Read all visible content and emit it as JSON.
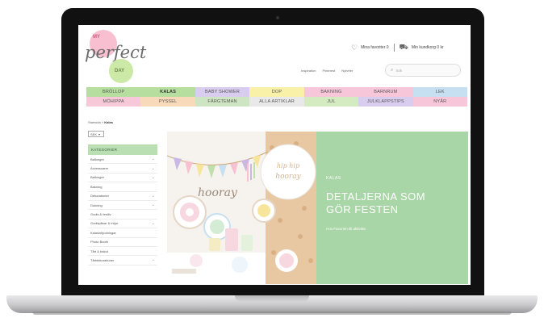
{
  "logo": {
    "my": "MY",
    "perfect": "perfect",
    "day": "DAY"
  },
  "header": {
    "favorites": "Mina favoriter 0",
    "cart": "Min kundkorg 0 kr"
  },
  "nav_links": [
    "Inspiration",
    "Pinterest",
    "Nyheter"
  ],
  "search": {
    "placeholder": "Sök"
  },
  "categories": [
    {
      "label": "BRÖLLOP",
      "color": "#b6de9f",
      "bold": false
    },
    {
      "label": "KALAS",
      "color": "#b6de9f",
      "bold": true
    },
    {
      "label": "BABY SHOWER",
      "color": "#d8cdee",
      "bold": false
    },
    {
      "label": "DOP",
      "color": "#f9f1a7",
      "bold": false
    },
    {
      "label": "BAKNING",
      "color": "#f7c7d9",
      "bold": false
    },
    {
      "label": "BARNRUM",
      "color": "#f7c7d9",
      "bold": false
    },
    {
      "label": "LEK",
      "color": "#c7e0f1",
      "bold": false
    },
    {
      "label": "MÖHIPPA",
      "color": "#f7c9d8",
      "bold": false
    },
    {
      "label": "PYSSEL",
      "color": "#f8d9ba",
      "bold": false
    },
    {
      "label": "FÄRGTEMAN",
      "color": "#cde5c2",
      "bold": false
    },
    {
      "label": "ALLA ARTIKLAR",
      "color": "#e9e9e9",
      "bold": false
    },
    {
      "label": "JUL",
      "color": "#d4ebc1",
      "bold": false
    },
    {
      "label": "JULKLAPPSTIPS",
      "color": "#d8cdee",
      "bold": false
    },
    {
      "label": "NYÅR",
      "color": "#f7c7d9",
      "bold": false
    }
  ],
  "breadcrumb": {
    "home": "Startsida",
    "sep": " » ",
    "current": "Kalas"
  },
  "sort_select": {
    "value": "SEK"
  },
  "sidebar": {
    "heading": "KATEGORIER",
    "items": [
      {
        "label": "Ballonger",
        "expand": true
      },
      {
        "label": "Accessoarer",
        "expand": true
      },
      {
        "label": "Ballonger",
        "expand": true
      },
      {
        "label": "Bakning",
        "expand": false
      },
      {
        "label": "Dekorationer",
        "expand": true
      },
      {
        "label": "Dukning",
        "expand": true
      },
      {
        "label": "Godis & festliv",
        "expand": false
      },
      {
        "label": "Godispåsar & tröjor",
        "expand": true
      },
      {
        "label": "Kalasinbjudningar",
        "expand": false
      },
      {
        "label": "Photo Booth",
        "expand": false
      },
      {
        "label": "Tårt & bakut",
        "expand": false
      },
      {
        "label": "Tårtdekorationer",
        "expand": true
      }
    ]
  },
  "hero": {
    "label": "KALAS",
    "title_line1": "DETALJERNA SOM",
    "title_line2": "GÖR FESTEN",
    "subtitle": "Hos Favorien till aktivitet",
    "balloon_text": "hip hip hooray",
    "banner_text": "hooray"
  }
}
